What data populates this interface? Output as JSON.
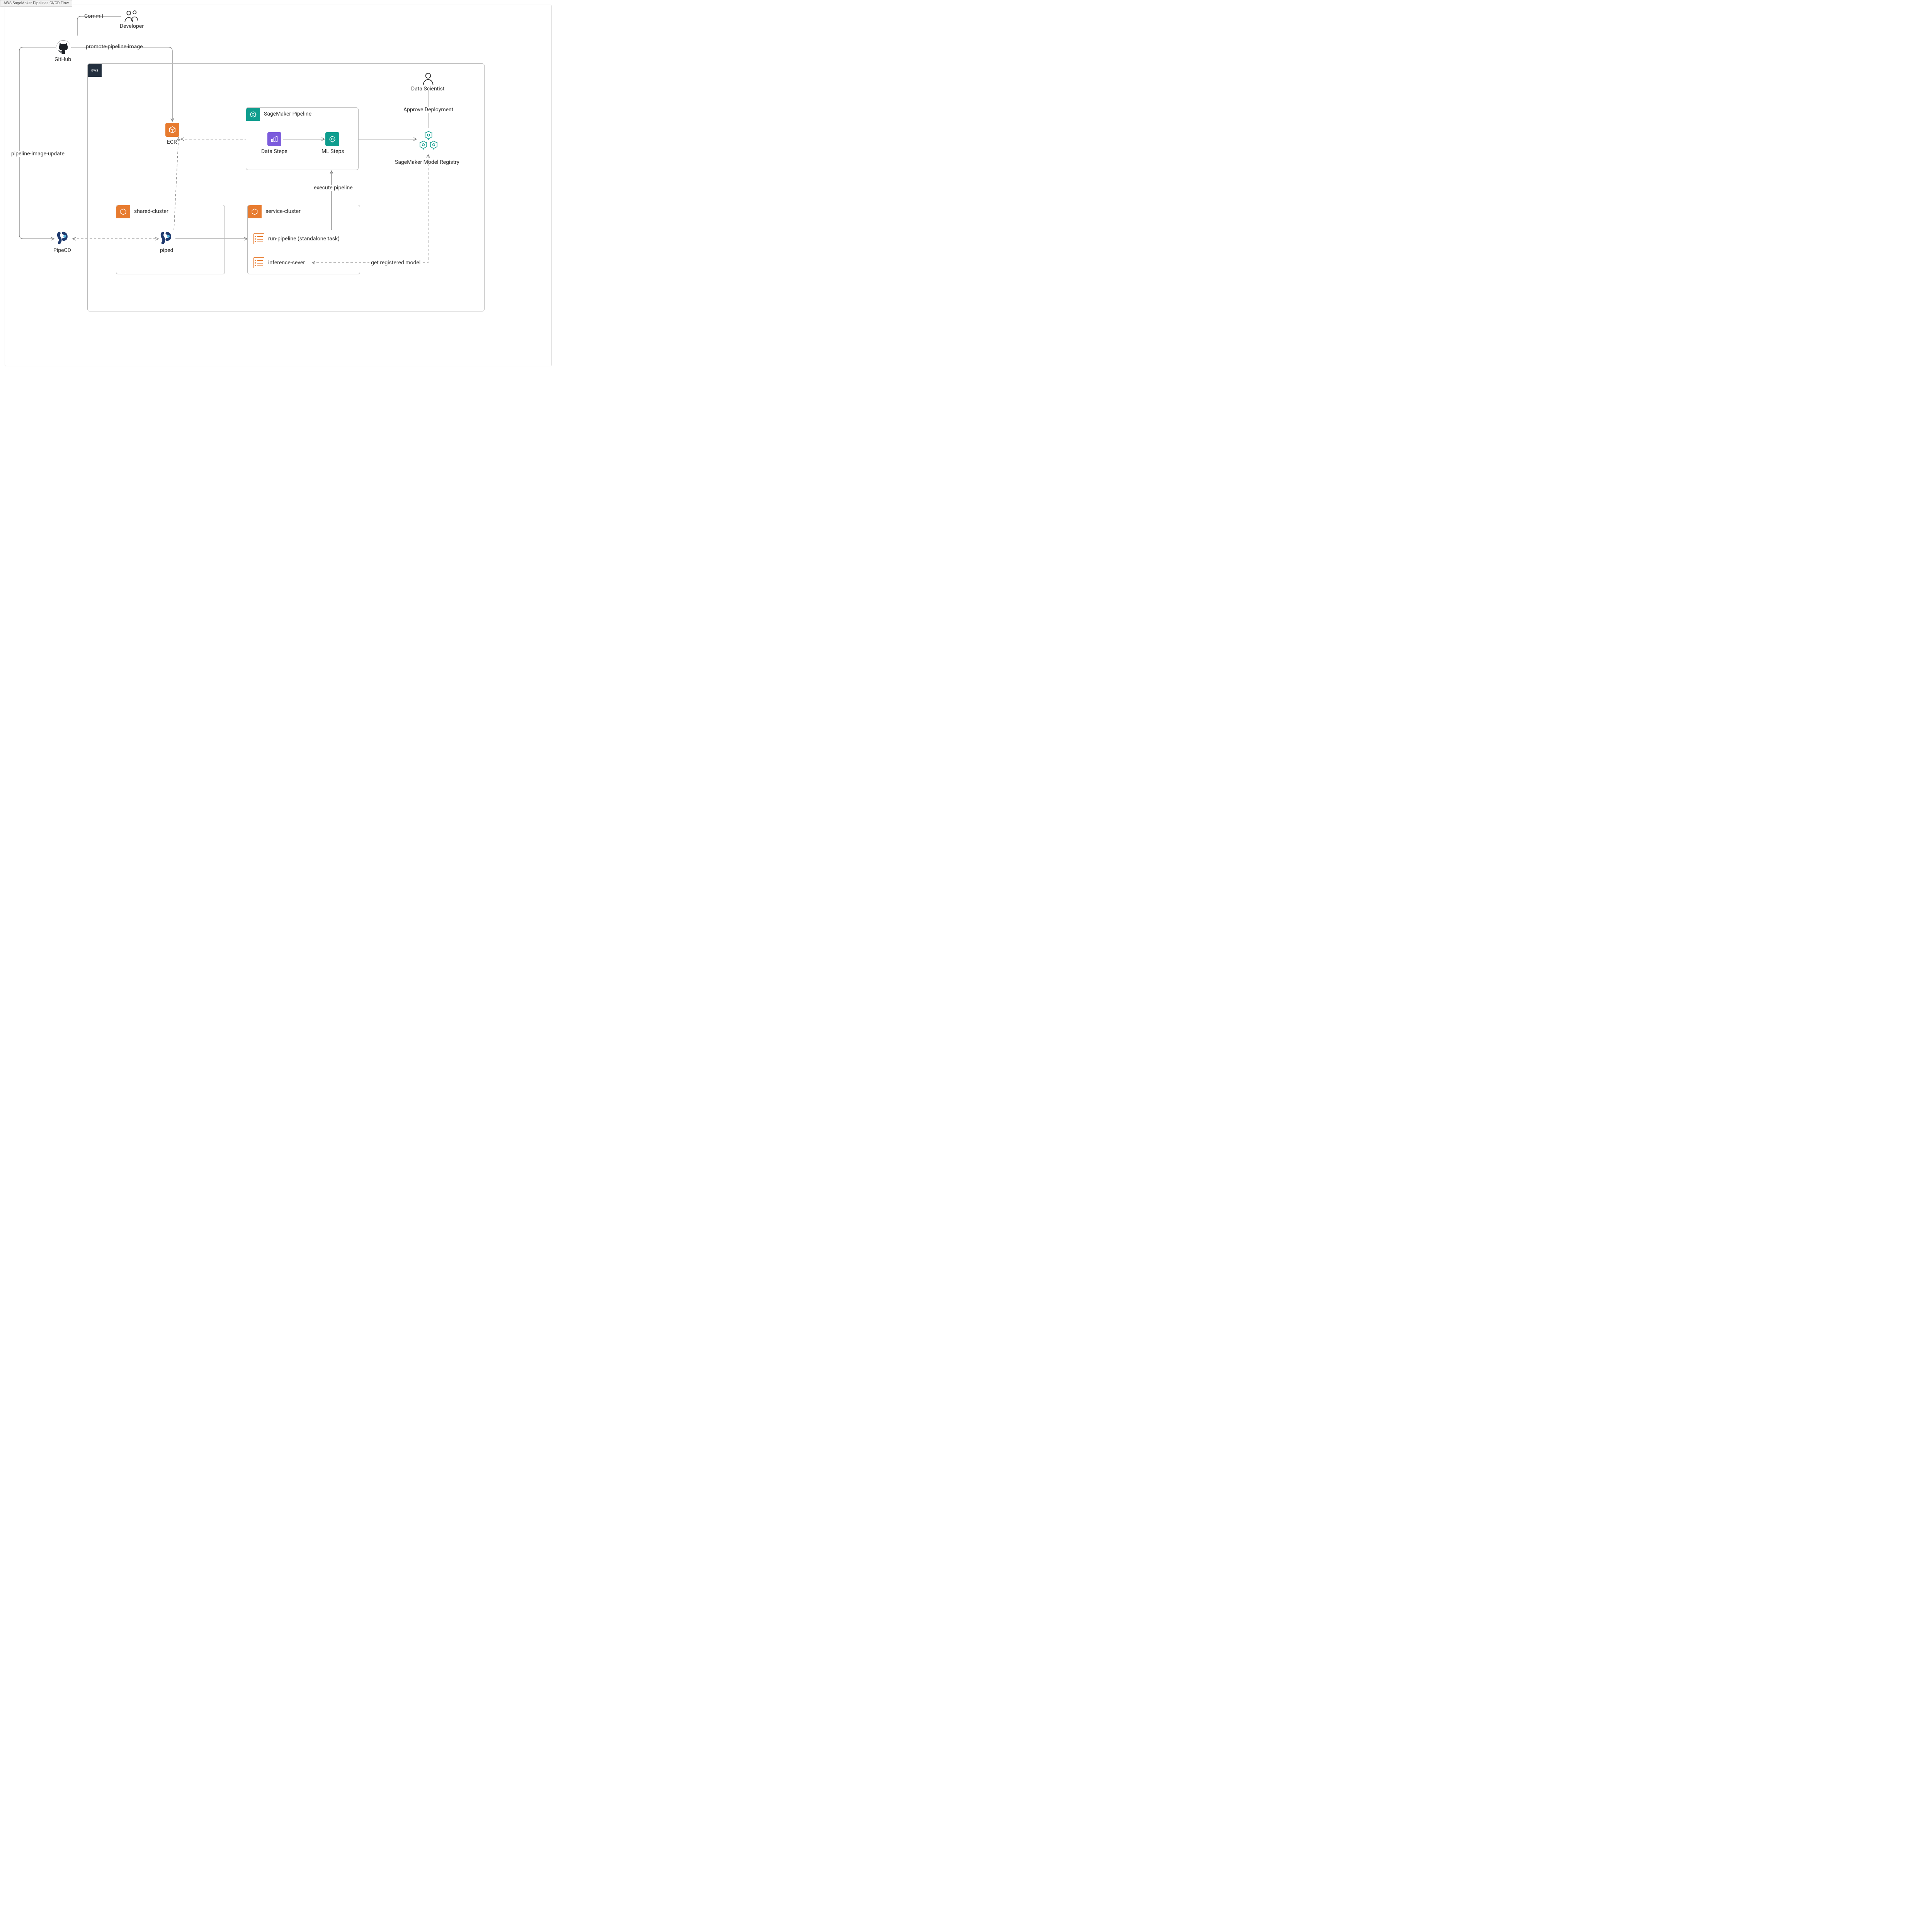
{
  "meta": {
    "tab_title": "AWS SageMaker Pipelines CI/CD Flow"
  },
  "actors": {
    "developer": "Developer",
    "data_scientist": "Data Scientist"
  },
  "nodes": {
    "github": "GitHub",
    "ecr": "ECR",
    "pipecd": "PipeCD",
    "piped": "piped",
    "run_pipeline": "run-pipeline (standalone task)",
    "inference_server": "inference-sever",
    "data_steps": "Data Steps",
    "ml_steps": "ML Steps",
    "model_registry": "SageMaker Model Registry"
  },
  "groups": {
    "aws": "aws",
    "shared_cluster": "shared-cluster",
    "service_cluster": "service-cluster",
    "sagemaker_pipeline": "SageMaker Pipeline"
  },
  "edges": {
    "commit": "Commit",
    "promote_pipeline_image": "promote-pipeline-image",
    "pipeline_image_update": "pipeline-image-update",
    "execute_pipeline": "execute pipeline",
    "approve_deployment": "Approve Deployment",
    "get_registered_model": "get registered model"
  },
  "colors": {
    "orange": "#e77b2f",
    "teal": "#0f9d8e",
    "purple": "#7c5cdc",
    "aws_navy": "#232f3e",
    "stroke": "#7d7d7d"
  }
}
